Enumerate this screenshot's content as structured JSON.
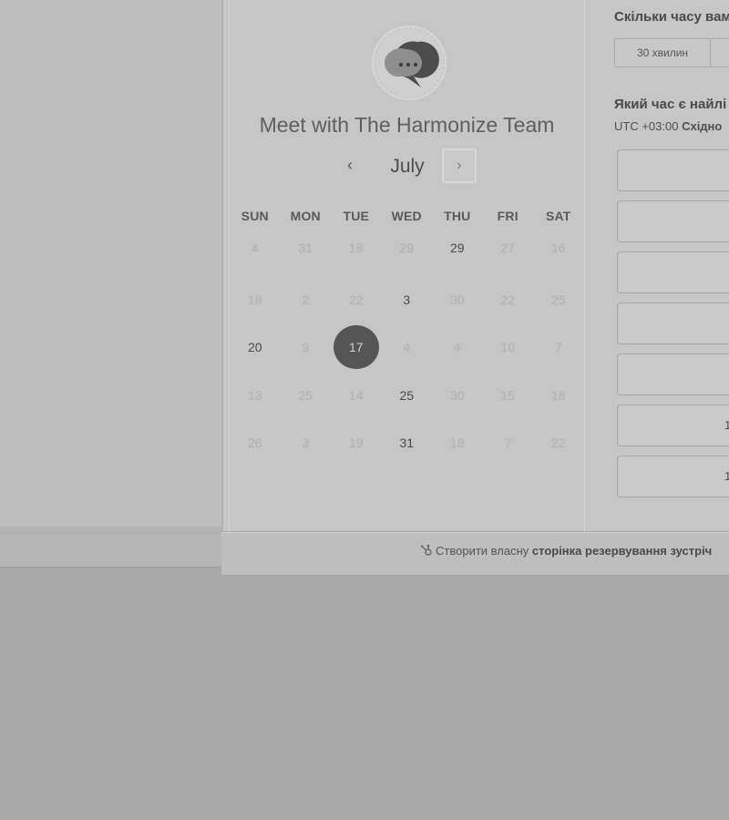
{
  "calendar": {
    "title": "Meet with The Harmonize Team",
    "month": "July",
    "prev_icon": "‹",
    "next_icon": "›",
    "weekdays": [
      "SUN",
      "MON",
      "TUE",
      "WED",
      "THU",
      "FRI",
      "SAT"
    ],
    "weeks": [
      [
        {
          "d": "4",
          "s": "muted"
        },
        {
          "d": "31",
          "s": "muted"
        },
        {
          "d": "18",
          "s": "muted"
        },
        {
          "d": "29",
          "s": "muted"
        },
        {
          "d": "29",
          "s": "avail"
        },
        {
          "d": "27",
          "s": "muted"
        },
        {
          "d": "16",
          "s": "muted"
        }
      ],
      [
        {
          "d": "18",
          "s": "muted"
        },
        {
          "d": "2",
          "s": "muted"
        },
        {
          "d": "22",
          "s": "muted"
        },
        {
          "d": "3",
          "s": "avail"
        },
        {
          "d": "30",
          "s": "muted"
        },
        {
          "d": "22",
          "s": "muted"
        },
        {
          "d": "25",
          "s": "muted"
        }
      ],
      [
        {
          "d": "20",
          "s": "avail"
        },
        {
          "d": "9",
          "s": "muted"
        },
        {
          "d": "17",
          "s": "selected"
        },
        {
          "d": "4",
          "s": "muted"
        },
        {
          "d": "4",
          "s": "muted"
        },
        {
          "d": "10",
          "s": "muted"
        },
        {
          "d": "7",
          "s": "muted"
        }
      ],
      [
        {
          "d": "13",
          "s": "muted"
        },
        {
          "d": "25",
          "s": "muted"
        },
        {
          "d": "14",
          "s": "muted"
        },
        {
          "d": "25",
          "s": "avail"
        },
        {
          "d": "30",
          "s": "muted"
        },
        {
          "d": "15",
          "s": "muted"
        },
        {
          "d": "18",
          "s": "muted"
        }
      ],
      [
        {
          "d": "26",
          "s": "muted"
        },
        {
          "d": "3",
          "s": "muted"
        },
        {
          "d": "19",
          "s": "muted"
        },
        {
          "d": "31",
          "s": "avail"
        },
        {
          "d": "18",
          "s": "muted"
        },
        {
          "d": "7",
          "s": "muted"
        },
        {
          "d": "22",
          "s": "muted"
        }
      ]
    ]
  },
  "right_panel": {
    "duration_question": "Скільки часу вам",
    "duration_options": [
      "30 хвилин",
      ""
    ],
    "time_question": "Який час є найлі",
    "timezone_prefix": "UTC +03:00",
    "timezone_name": "Східно",
    "slots": [
      "",
      "",
      "",
      "",
      "",
      "1",
      "1"
    ]
  },
  "footer": {
    "text_plain": "Створити власну",
    "text_bold": "сторінка резервування зустріч"
  },
  "colors": {
    "selected_day_bg": "#555555",
    "background": "#a8a8a8"
  },
  "icons": {
    "logo": "chat-bubble-icon",
    "footer": "hubspot-sprocket-icon"
  }
}
